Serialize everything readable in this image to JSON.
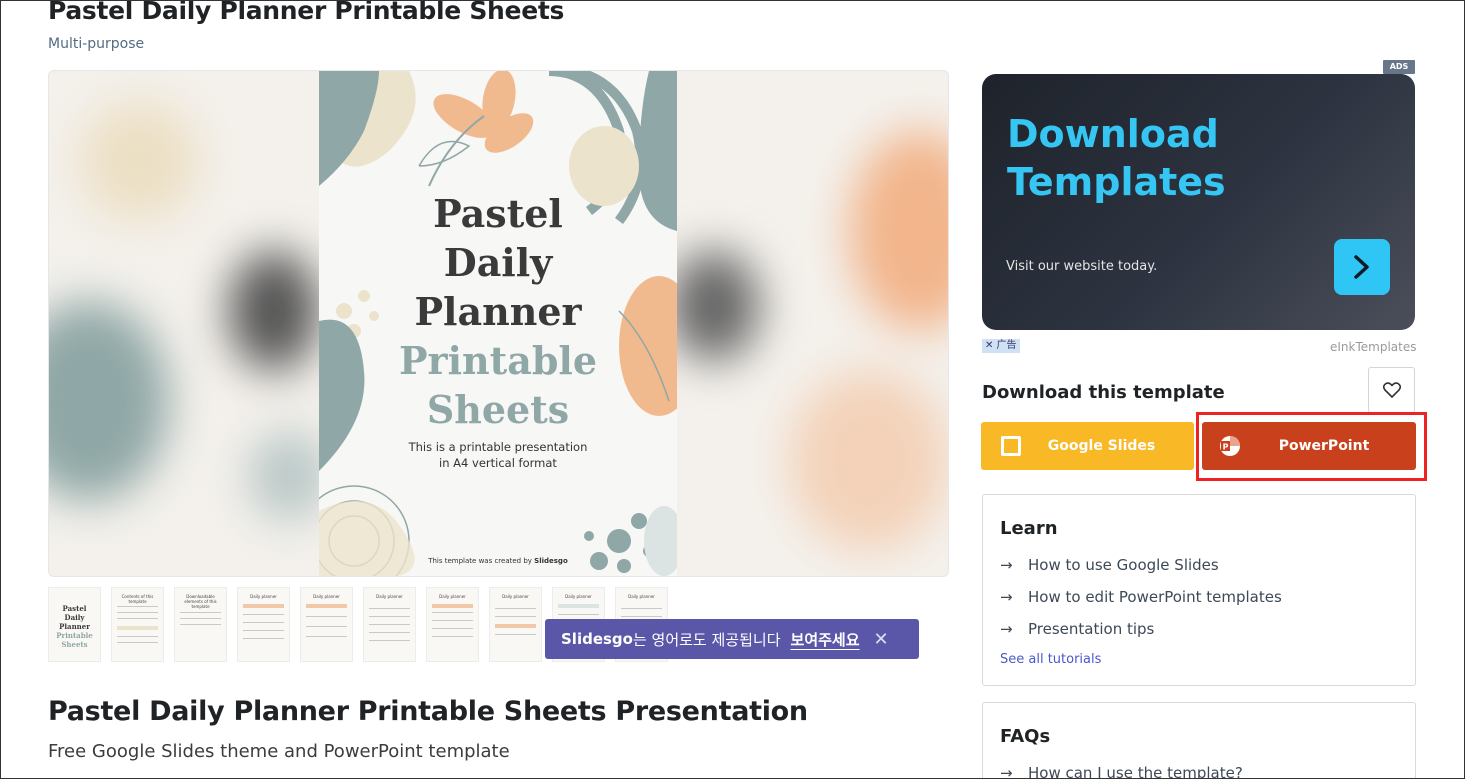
{
  "page": {
    "title": "Pastel Daily Planner Printable Sheets",
    "category": "Multi-purpose",
    "heading": "Pastel Daily Planner Printable Sheets Presentation",
    "subheading": "Free Google Slides theme and PowerPoint template"
  },
  "preview": {
    "slide_title_line1": "Pastel",
    "slide_title_line2": "Daily",
    "slide_title_line3": "Planner",
    "slide_title_line4": "Printable",
    "slide_title_line5": "Sheets",
    "slide_desc_line1": "This is a printable presentation",
    "slide_desc_line2": "in A4 vertical format",
    "slide_credit": "This template was created by",
    "slide_credit_brand": "Slidesgo"
  },
  "thumbnails": [
    {
      "title": "Pastel Daily Planner Printable Sheets"
    },
    {
      "title": "Contents of this template"
    },
    {
      "title": "Downloadable elements of this template"
    },
    {
      "title": "Daily planner"
    },
    {
      "title": "Daily planner"
    },
    {
      "title": "Daily planner"
    },
    {
      "title": "Daily planner"
    },
    {
      "title": "Daily planner"
    },
    {
      "title": "Daily planner"
    },
    {
      "title": "Daily planner"
    }
  ],
  "toast": {
    "brand": "Slidesgo",
    "message": "는 영어로도 제공됩니다",
    "cta": "보여주세요",
    "close": "✕"
  },
  "ad": {
    "tag": "ADS",
    "headline_line1": "Download",
    "headline_line2": "Templates",
    "subtext": "Visit our website today.",
    "close_label": "✕ 广告",
    "brand": "eInkTemplates"
  },
  "download": {
    "label": "Download this template",
    "google_slides": "Google Slides",
    "powerpoint": "PowerPoint"
  },
  "learn": {
    "title": "Learn",
    "links": [
      "How to use Google Slides",
      "How to edit PowerPoint templates",
      "Presentation tips"
    ],
    "all": "See all tutorials"
  },
  "faqs": {
    "title": "FAQs",
    "links": [
      "How can I use the template?"
    ]
  },
  "colors": {
    "google_slides": "#f9b826",
    "powerpoint": "#c8411c",
    "accent_teal": "#8fa7a6",
    "toast_bg": "#5a56a8",
    "ad_cyan": "#35c6f4"
  }
}
